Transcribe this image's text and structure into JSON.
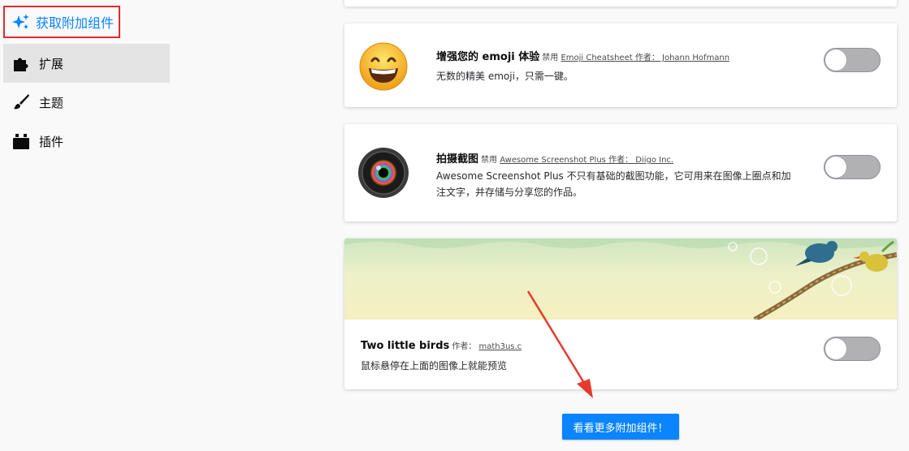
{
  "sidebar": {
    "get_addons_label": "获取附加组件",
    "items": [
      {
        "label": "扩展",
        "icon": "puzzle-icon",
        "selected": true
      },
      {
        "label": "主题",
        "icon": "brush-icon",
        "selected": false
      },
      {
        "label": "插件",
        "icon": "plugin-icon",
        "selected": false
      }
    ]
  },
  "addons": [
    {
      "name": "增强您的 emoji 体验",
      "status": "禁用",
      "link": "Emoji Cheatsheet 作者： Johann Hofmann",
      "description": "无数的精美 emoji，只需一键。",
      "icon": "emoji-icon",
      "enabled": false
    },
    {
      "name": "拍摄截图",
      "status": "禁用",
      "link": "Awesome Screenshot Plus 作者： Diigo Inc.",
      "description": "Awesome Screenshot Plus 不只有基础的截图功能，它可用来在图像上圈点和加注文字，并存储与分享您的作品。",
      "icon": "camera-lens-icon",
      "enabled": false
    }
  ],
  "theme": {
    "name": "Two little birds",
    "author_prefix": "作者：",
    "author": "math3us.c",
    "description": "鼠标悬停在上面的图像上就能预览",
    "enabled": false
  },
  "more_button_label": "看看更多附加组件！",
  "colors": {
    "accent": "#0a84ff",
    "highlight_border": "#e22b2b",
    "annotation_arrow": "#e8392e"
  }
}
